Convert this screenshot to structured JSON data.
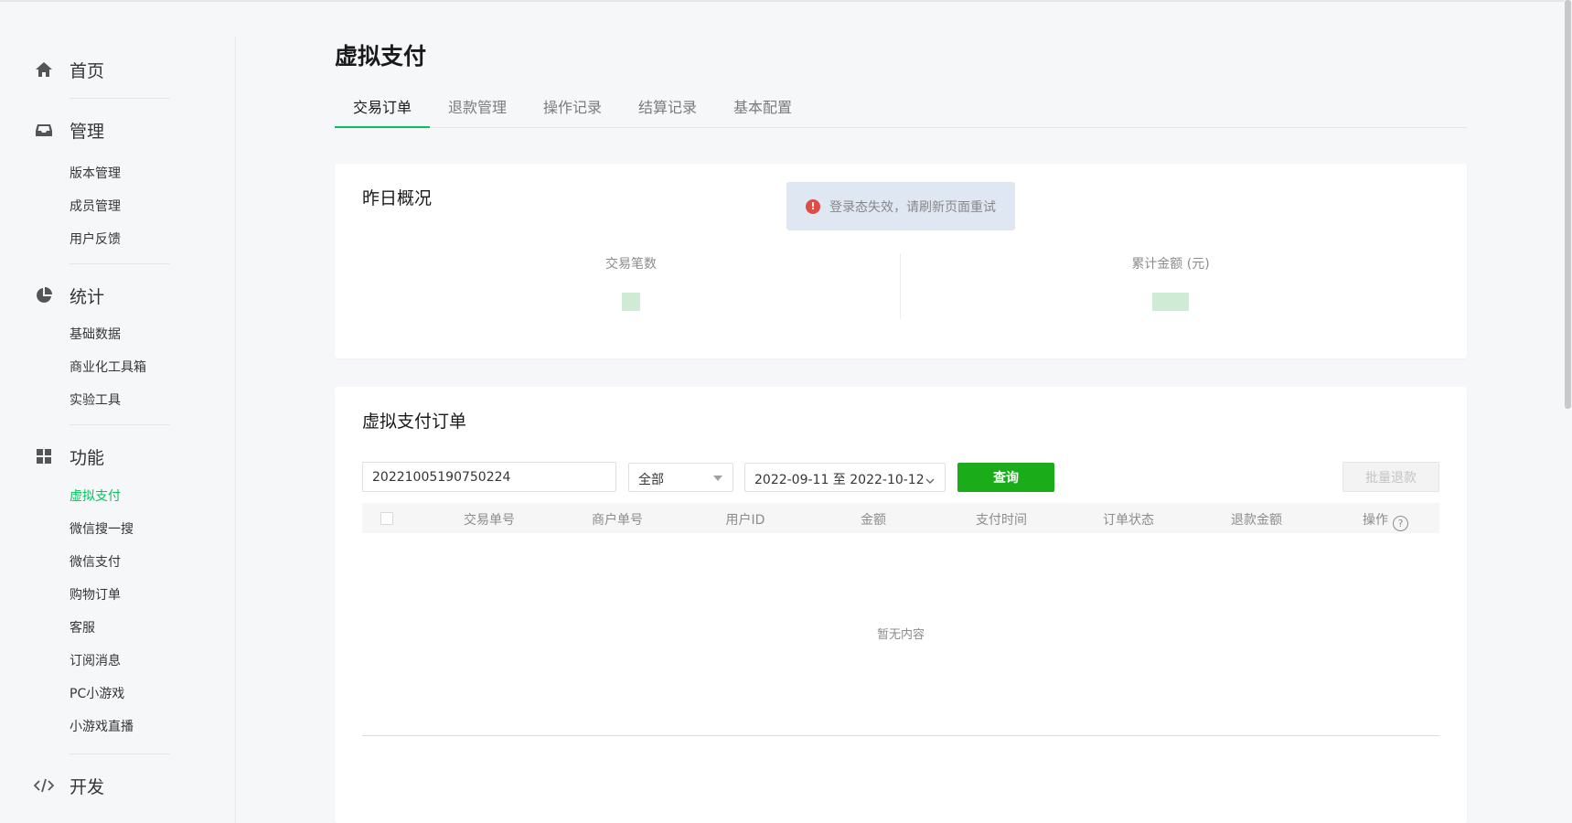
{
  "sidebar": {
    "home": {
      "label": "首页",
      "icon": "home-icon"
    },
    "manage": {
      "label": "管理",
      "icon": "inbox-icon",
      "items": [
        "版本管理",
        "成员管理",
        "用户反馈"
      ]
    },
    "stats": {
      "label": "统计",
      "icon": "pie-chart-icon",
      "items": [
        "基础数据",
        "商业化工具箱",
        "实验工具"
      ]
    },
    "features": {
      "label": "功能",
      "icon": "grid-icon",
      "items": [
        "虚拟支付",
        "微信搜一搜",
        "微信支付",
        "购物订单",
        "客服",
        "订阅消息",
        "PC小游戏",
        "小游戏直播"
      ],
      "active_index": 0
    },
    "dev": {
      "label": "开发",
      "icon": "code-icon"
    }
  },
  "page": {
    "title": "虚拟支付",
    "tabs": [
      "交易订单",
      "退款管理",
      "操作记录",
      "结算记录",
      "基本配置"
    ],
    "active_tab": 0
  },
  "toast": {
    "message": "登录态失效，请刷新页面重试",
    "icon": "warning-icon"
  },
  "overview": {
    "title": "昨日概况",
    "stats": [
      {
        "label": "交易笔数"
      },
      {
        "label": "累计金额 (元)"
      }
    ]
  },
  "orders": {
    "title": "虚拟支付订单",
    "search_value": "20221005190750224",
    "status_select": "全部",
    "date_range": "2022-09-11 至 2022-10-12",
    "query_button": "查询",
    "batch_refund_button": "批量退款",
    "columns": [
      "交易单号",
      "商户单号",
      "用户ID",
      "金额",
      "支付时间",
      "订单状态",
      "退款金额",
      "操作"
    ],
    "help_mark": "?",
    "empty_text": "暂无内容"
  },
  "colors": {
    "accent": "#07c160",
    "button": "#1aad19",
    "toast_bg": "#dfe7f2",
    "error": "#e04b46"
  }
}
